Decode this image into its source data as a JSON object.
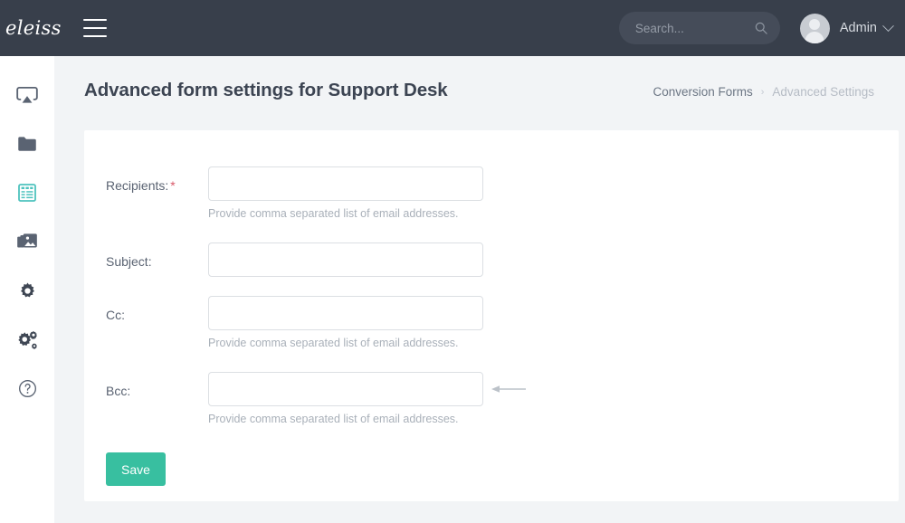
{
  "topbar": {
    "brand": "eleiss",
    "menu_icon": "hamburger-icon",
    "search": {
      "placeholder": "Search...",
      "value": "",
      "icon": "search-icon"
    },
    "user": {
      "name": "Admin",
      "avatar": "user-avatar",
      "chevron": "chevron-down-icon"
    },
    "background_color": "#383f4b"
  },
  "sidebar": {
    "active_index": 2,
    "active_color": "#4ec3be",
    "icon_color": "#5a6372",
    "items": [
      {
        "name": "dashboard-airplay-icon",
        "label": "Dashboard"
      },
      {
        "name": "folder-icon",
        "label": "Files"
      },
      {
        "name": "forms-icon",
        "label": "Conversion Forms"
      },
      {
        "name": "images-icon",
        "label": "Media"
      },
      {
        "name": "gear-icon",
        "label": "Settings"
      },
      {
        "name": "gears-icon",
        "label": "Advanced Settings"
      },
      {
        "name": "help-circle-icon",
        "label": "Help"
      }
    ]
  },
  "page": {
    "title": "Advanced form settings for Support Desk",
    "breadcrumb": {
      "parent": "Conversion Forms",
      "separator": "›",
      "current": "Advanced Settings"
    }
  },
  "form": {
    "fields": [
      {
        "label": "Recipients:",
        "required": true,
        "required_marker": "*",
        "value": "",
        "placeholder": "",
        "help": "Provide comma separated list of email addresses."
      },
      {
        "label": "Subject:",
        "required": false,
        "required_marker": "",
        "value": "",
        "placeholder": "",
        "help": ""
      },
      {
        "label": "Cc:",
        "required": false,
        "required_marker": "",
        "value": "",
        "placeholder": "",
        "help": "Provide comma separated list of email addresses."
      },
      {
        "label": "Bcc:",
        "required": false,
        "required_marker": "",
        "value": "",
        "placeholder": "",
        "help": "Provide comma separated list of email addresses.",
        "annotation": "arrow-left-icon"
      }
    ],
    "save_label": "Save",
    "save_color": "#38bfa0"
  }
}
